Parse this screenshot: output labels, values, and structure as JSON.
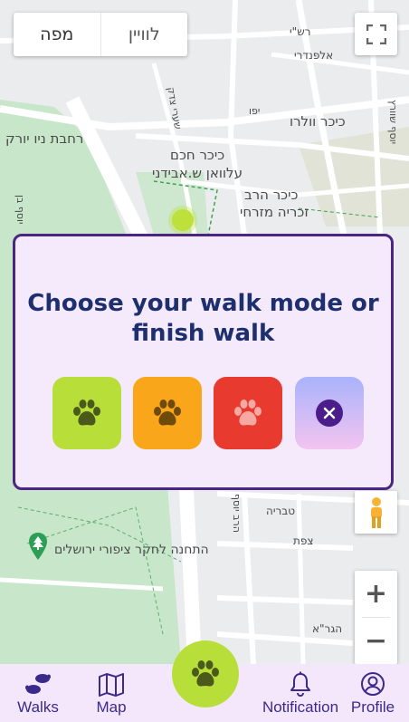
{
  "map": {
    "map_type": {
      "map_label": "מפה",
      "satellite_label": "לוויין",
      "selected": "map"
    },
    "labels": {
      "rashi": "רש\"י",
      "alfandari": "אלפנדרי",
      "volero_sq": "כיכר וולרו",
      "yosef_shvarts": "יוסף שוורץ",
      "shaarei_tsedek": "שערי צדק",
      "yafo": "יפו",
      "ny_square": "רחבת ניו יורק",
      "hacham_sq": "כיכר חכם",
      "avidani": "עלוואן ש.אבידני",
      "harav_sq": "כיכר הרב",
      "zecharia": "זכריה מזרחי",
      "yosef_ben": "יוסף בן",
      "tveria": "טבריה",
      "tsfat": "צפת",
      "bird_station": "התחנה לחקר ציפורי ירושלים",
      "hagra": "הגר\"א",
      "harav_yosef": "הרב יוסף"
    },
    "zoom_in": "+",
    "zoom_out": "−"
  },
  "modal": {
    "title": "Choose your walk mode or finish walk",
    "modes": [
      {
        "name": "walk-mode-green-button",
        "color": "#b8df39"
      },
      {
        "name": "walk-mode-orange-button",
        "color": "#f9a61a"
      },
      {
        "name": "walk-mode-red-button",
        "color": "#e83a2e"
      }
    ],
    "finish_colors": [
      "#a9b3fb",
      "#f3c4f0"
    ]
  },
  "navbar": {
    "items": [
      {
        "label": "Walks",
        "icon": "footprints-icon"
      },
      {
        "label": "Map",
        "icon": "map-icon"
      },
      {
        "label": "Notification",
        "icon": "bell-icon"
      },
      {
        "label": "Profile",
        "icon": "user-circle-icon"
      }
    ],
    "fab_icon": "paw-icon",
    "accent": "#3b2a8c"
  }
}
